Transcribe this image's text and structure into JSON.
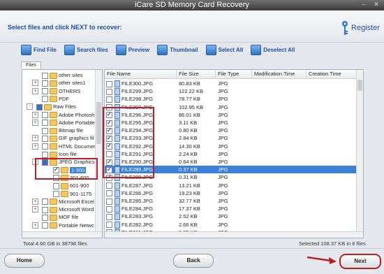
{
  "window": {
    "title": "iCare SD Memory Card Recovery"
  },
  "header": {
    "instruction": "Select files and click NEXT to recover:",
    "register_label": "Register"
  },
  "toolbar": [
    {
      "label": "Find File",
      "icon": "find-file-icon"
    },
    {
      "label": "Search files",
      "icon": "search-files-icon"
    },
    {
      "label": "Preview",
      "icon": "preview-icon"
    },
    {
      "label": "Thumbnail",
      "icon": "thumbnail-icon"
    },
    {
      "label": "Select All",
      "icon": "select-all-icon"
    },
    {
      "label": "Deselect All",
      "icon": "deselect-all-icon"
    }
  ],
  "tabs": [
    "Files"
  ],
  "tree": [
    {
      "label": "other sites",
      "level": 2,
      "exp": "",
      "cb": "off"
    },
    {
      "label": "other sites1",
      "level": 2,
      "exp": "+",
      "cb": "off"
    },
    {
      "label": "OTHERS",
      "level": 2,
      "exp": "+",
      "cb": "off"
    },
    {
      "label": "PDF",
      "level": 2,
      "exp": "",
      "cb": "off"
    },
    {
      "label": "Raw Files",
      "level": 1,
      "exp": "-",
      "cb": "part"
    },
    {
      "label": "Adobe Photosh",
      "level": 2,
      "exp": "+",
      "cb": "off"
    },
    {
      "label": "Adobe Portable",
      "level": 2,
      "exp": "+",
      "cb": "off"
    },
    {
      "label": "Bitmap file",
      "level": 2,
      "exp": "",
      "cb": "off"
    },
    {
      "label": "GIF graphics fil",
      "level": 2,
      "exp": "+",
      "cb": "off"
    },
    {
      "label": "HTML Documen",
      "level": 2,
      "exp": "+",
      "cb": "off"
    },
    {
      "label": "Icon file",
      "level": 2,
      "exp": "",
      "cb": "off"
    },
    {
      "label": "JPEG Graphics",
      "level": 2,
      "exp": "-",
      "cb": "part"
    },
    {
      "label": "1-300",
      "level": 3,
      "exp": "",
      "cb": "on"
    },
    {
      "label": "301-600",
      "level": 3,
      "exp": "",
      "cb": "off"
    },
    {
      "label": "601-900",
      "level": 3,
      "exp": "",
      "cb": "off"
    },
    {
      "label": "901-1175",
      "level": 3,
      "exp": "",
      "cb": "off"
    },
    {
      "label": "Microsoft Excel",
      "level": 2,
      "exp": "+",
      "cb": "off"
    },
    {
      "label": "Microsoft Word",
      "level": 2,
      "exp": "+",
      "cb": "off"
    },
    {
      "label": "MOF file",
      "level": 2,
      "exp": "",
      "cb": "off"
    },
    {
      "label": "Portable Netwc",
      "level": 2,
      "exp": "+",
      "cb": "off"
    }
  ],
  "table": {
    "columns": [
      "File Name",
      "File Size",
      "File Type",
      "Modification Time",
      "Creation Time"
    ],
    "rows": [
      {
        "name": "FILE300.JPG",
        "size": "80.83 KB",
        "type": "JPG",
        "checked": false,
        "selected": false
      },
      {
        "name": "FILE299.JPG",
        "size": "122.22 KB",
        "type": "JPG",
        "checked": false,
        "selected": false
      },
      {
        "name": "FILE298.JPG",
        "size": "78.77 KB",
        "type": "JPG",
        "checked": false,
        "selected": false
      },
      {
        "name": "FILE297.JPG",
        "size": "102.95 KB",
        "type": "JPG",
        "checked": false,
        "selected": false
      },
      {
        "name": "FILE296.JPG",
        "size": "86.01 KB",
        "type": "JPG",
        "checked": true,
        "selected": false
      },
      {
        "name": "FILE295.JPG",
        "size": "3.11 KB",
        "type": "JPG",
        "checked": true,
        "selected": false
      },
      {
        "name": "FILE294.JPG",
        "size": "0.80 KB",
        "type": "JPG",
        "checked": true,
        "selected": false
      },
      {
        "name": "FILE293.JPG",
        "size": "2.84 KB",
        "type": "JPG",
        "checked": true,
        "selected": false
      },
      {
        "name": "FILE292.JPG",
        "size": "14.30 KB",
        "type": "JPG",
        "checked": true,
        "selected": false
      },
      {
        "name": "FILE291.JPG",
        "size": "2.24 KB",
        "type": "JPG",
        "checked": false,
        "selected": false
      },
      {
        "name": "FILE290.JPG",
        "size": "0.64 KB",
        "type": "JPG",
        "checked": true,
        "selected": false
      },
      {
        "name": "FILE289.JPG",
        "size": "0.37 KB",
        "type": "JPG",
        "checked": true,
        "selected": true
      },
      {
        "name": "FILE288.JPG",
        "size": "0.31 KB",
        "type": "JPG",
        "checked": true,
        "selected": false
      },
      {
        "name": "FILE287.JPG",
        "size": "13.21 KB",
        "type": "JPG",
        "checked": false,
        "selected": false
      },
      {
        "name": "FILE286.JPG",
        "size": "19.23 KB",
        "type": "JPG",
        "checked": false,
        "selected": false
      },
      {
        "name": "FILE285.JPG",
        "size": "32.77 KB",
        "type": "JPG",
        "checked": false,
        "selected": false
      },
      {
        "name": "FILE284.JPG",
        "size": "17.37 KB",
        "type": "JPG",
        "checked": false,
        "selected": false
      },
      {
        "name": "FILE283.JPG",
        "size": "2.52 KB",
        "type": "JPG",
        "checked": false,
        "selected": false
      },
      {
        "name": "FILE282.JPG",
        "size": "2.66 KB",
        "type": "JPG",
        "checked": false,
        "selected": false
      },
      {
        "name": "FILE281.JPG",
        "size": "5.25 KB",
        "type": "JPG",
        "checked": false,
        "selected": false
      }
    ]
  },
  "status": {
    "total": "Total 4.60 GB in 38796 files",
    "selected": "Selected 108.37 KB in 8 files"
  },
  "footer": {
    "home_label": "Home",
    "back_label": "Back",
    "next_label": "Next"
  },
  "colors": {
    "accent": "#1e4fa2",
    "highlight": "#b62026",
    "selection": "#3a7fd8"
  }
}
